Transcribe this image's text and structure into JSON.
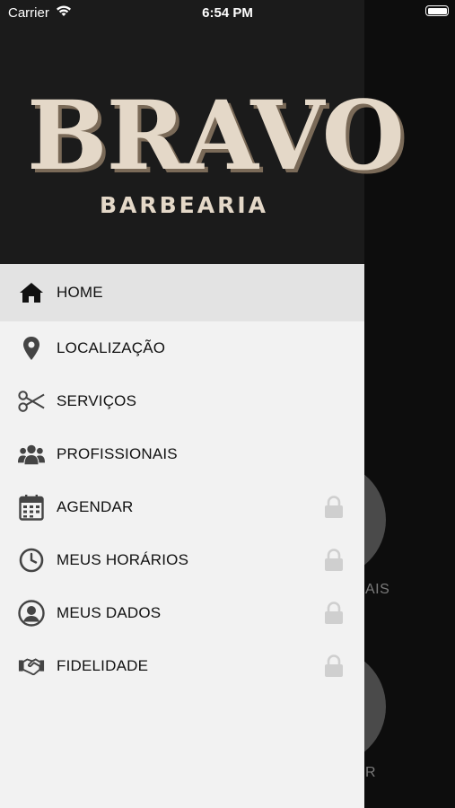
{
  "status_bar": {
    "carrier": "Carrier",
    "time": "6:54 PM"
  },
  "logo": {
    "title": "BRAVO",
    "subtitle": "BARBEARIA"
  },
  "menu": {
    "items": [
      {
        "label": "HOME",
        "icon": "home-icon",
        "active": true,
        "locked": false
      },
      {
        "label": "LOCALIZAÇÃO",
        "icon": "location-pin-icon",
        "locked": false
      },
      {
        "label": "SERVIÇOS",
        "icon": "scissors-icon",
        "locked": false
      },
      {
        "label": "PROFISSIONAIS",
        "icon": "group-icon",
        "locked": false
      },
      {
        "label": "AGENDAR",
        "icon": "calendar-icon",
        "locked": true
      },
      {
        "label": "MEUS HORÁRIOS",
        "icon": "clock-icon",
        "locked": true
      },
      {
        "label": "MEUS DADOS",
        "icon": "user-icon",
        "locked": true
      },
      {
        "label": "FIDELIDADE",
        "icon": "handshake-icon",
        "locked": true
      }
    ]
  },
  "background": {
    "label_1": "AIS",
    "label_2": "R"
  },
  "colors": {
    "drawer_bg": "#f2f2f2",
    "header_bg": "#1b1b1b",
    "active_row": "#e3e3e3",
    "logo_cream": "#e4d8c8",
    "lock_gray": "#cfcfcf",
    "icon_dark": "#333333"
  }
}
